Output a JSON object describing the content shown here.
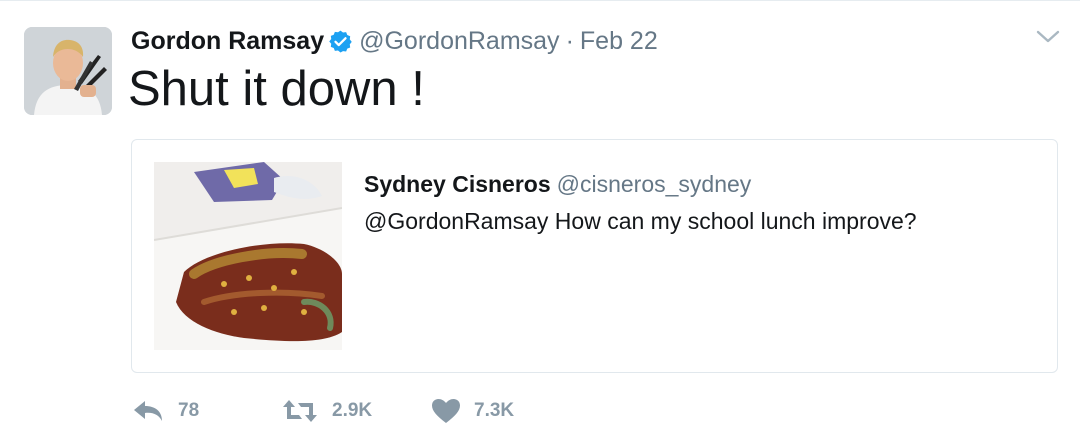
{
  "tweet": {
    "author": {
      "name": "Gordon Ramsay",
      "handle": "@GordonRamsay",
      "separator": "·",
      "date": "Feb 22"
    },
    "text": "Shut it down !",
    "quoted": {
      "name": "Sydney Cisneros",
      "handle": "@cisneros_sydney",
      "text": "@GordonRamsay How can my school lunch improve?"
    },
    "actions": {
      "reply_count": "78",
      "retweet_count": "2.9K",
      "like_count": "7.3K"
    }
  },
  "icons": {
    "verified": "verified-badge-icon",
    "caret": "chevron-down-icon",
    "reply": "reply-icon",
    "retweet": "retweet-icon",
    "like": "heart-icon"
  },
  "colors": {
    "text": "#14171a",
    "secondary": "#657786",
    "action": "#8899a6",
    "verified": "#1da1f2",
    "border": "#e1e8ed"
  }
}
